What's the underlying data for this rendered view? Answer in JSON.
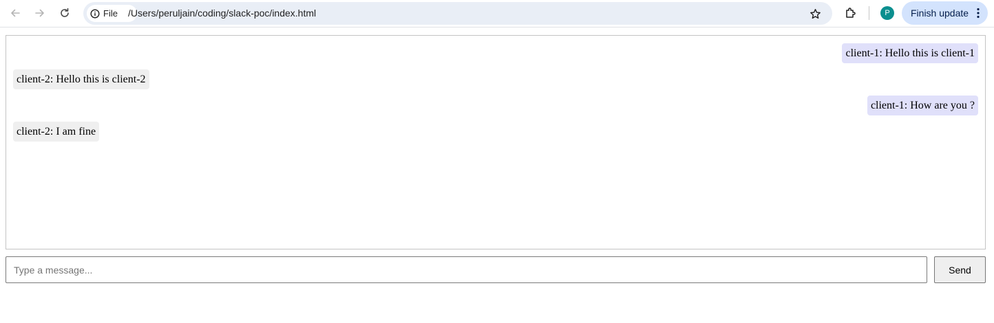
{
  "browser": {
    "site_chip_label": "File",
    "url": "/Users/peruljain/coding/slack-poc/index.html",
    "profile_initial": "P",
    "update_label": "Finish update"
  },
  "chat": {
    "messages": [
      {
        "sender": "client-1",
        "text": "client-1: Hello this is client-1",
        "side": "self"
      },
      {
        "sender": "client-2",
        "text": "client-2: Hello this is client-2",
        "side": "other"
      },
      {
        "sender": "client-1",
        "text": "client-1: How are you ?",
        "side": "self"
      },
      {
        "sender": "client-2",
        "text": "client-2: I am fine",
        "side": "other"
      }
    ]
  },
  "composer": {
    "placeholder": "Type a message...",
    "value": "",
    "send_label": "Send"
  },
  "colors": {
    "self_bubble": "#e0e0fa",
    "other_bubble": "#efefef",
    "omnibox_bg": "#e9eef6",
    "update_bg": "#d3e3fd",
    "avatar_bg": "#0b8f8f"
  }
}
